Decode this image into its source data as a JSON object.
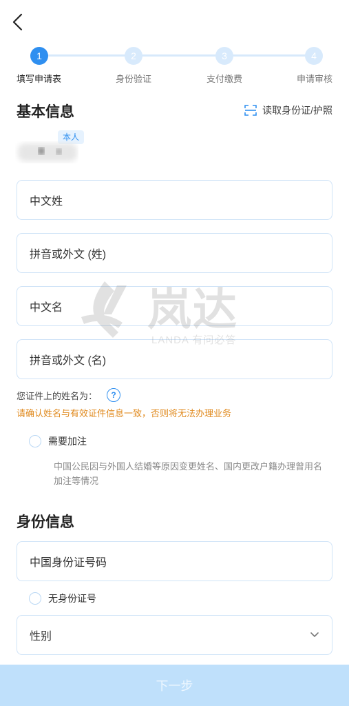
{
  "steps": [
    {
      "num": "1",
      "label": "填写申请表"
    },
    {
      "num": "2",
      "label": "身份验证"
    },
    {
      "num": "3",
      "label": "支付缴费"
    },
    {
      "num": "4",
      "label": "申请审核"
    }
  ],
  "basic_info": {
    "title": "基本信息",
    "read_id_label": "读取身份证/护照",
    "tag": "本人",
    "fields": {
      "cn_surname": "中文姓",
      "pinyin_surname": "拼音或外文 (姓)",
      "cn_given": "中文名",
      "pinyin_given": "拼音或外文 (名)"
    },
    "name_on_id_label": "您证件上的姓名为：",
    "help_glyph": "?",
    "warning": "请确认姓名与有效证件信息一致，否则将无法办理业务",
    "need_annotation_label": "需要加注",
    "annotation_note": "中国公民因与外国人结婚等原因变更姓名、国内更改户籍办理曾用名加注等情况"
  },
  "identity_info": {
    "title": "身份信息",
    "id_number_placeholder": "中国身份证号码",
    "no_id_label": "无身份证号",
    "gender_label": "性别"
  },
  "next_button": "下一步",
  "watermark": {
    "brand": "岚达",
    "sub": "LANDA  有问必答"
  },
  "colors": {
    "primary": "#2f8ff0",
    "warning": "#e08a1e",
    "button_disabled": "#bfe0fb"
  }
}
